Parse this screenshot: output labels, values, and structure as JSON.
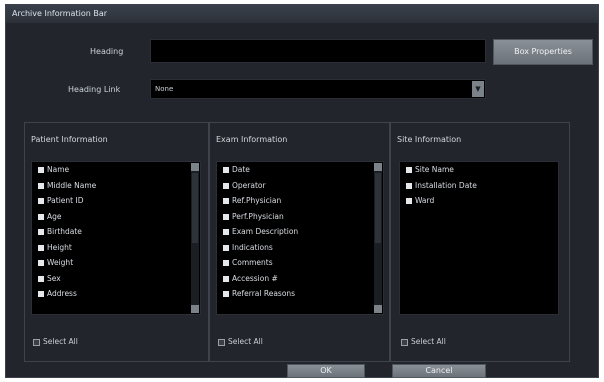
{
  "dialog": {
    "title": "Archive Information Bar"
  },
  "heading": {
    "label": "Heading",
    "value": ""
  },
  "box_properties_label": "Box Properties",
  "heading_link": {
    "label": "Heading Link",
    "value": "None"
  },
  "groups": [
    {
      "title": "Patient Information",
      "items": [
        "Name",
        "Middle Name",
        "Patient ID",
        "Age",
        "Birthdate",
        "Height",
        "Weight",
        "Sex",
        "Address"
      ],
      "select_all": "Select All"
    },
    {
      "title": "Exam Information",
      "items": [
        "Date",
        "Operator",
        "Ref.Physician",
        "Perf.Physician",
        "Exam Description",
        "Indications",
        "Comments",
        "Accession #",
        "Referral Reasons"
      ],
      "select_all": "Select All"
    },
    {
      "title": "Site Information",
      "items": [
        "Site Name",
        "Installation Date",
        "Ward"
      ],
      "select_all": "Select All"
    }
  ],
  "buttons": {
    "ok": "OK",
    "cancel": "Cancel"
  }
}
